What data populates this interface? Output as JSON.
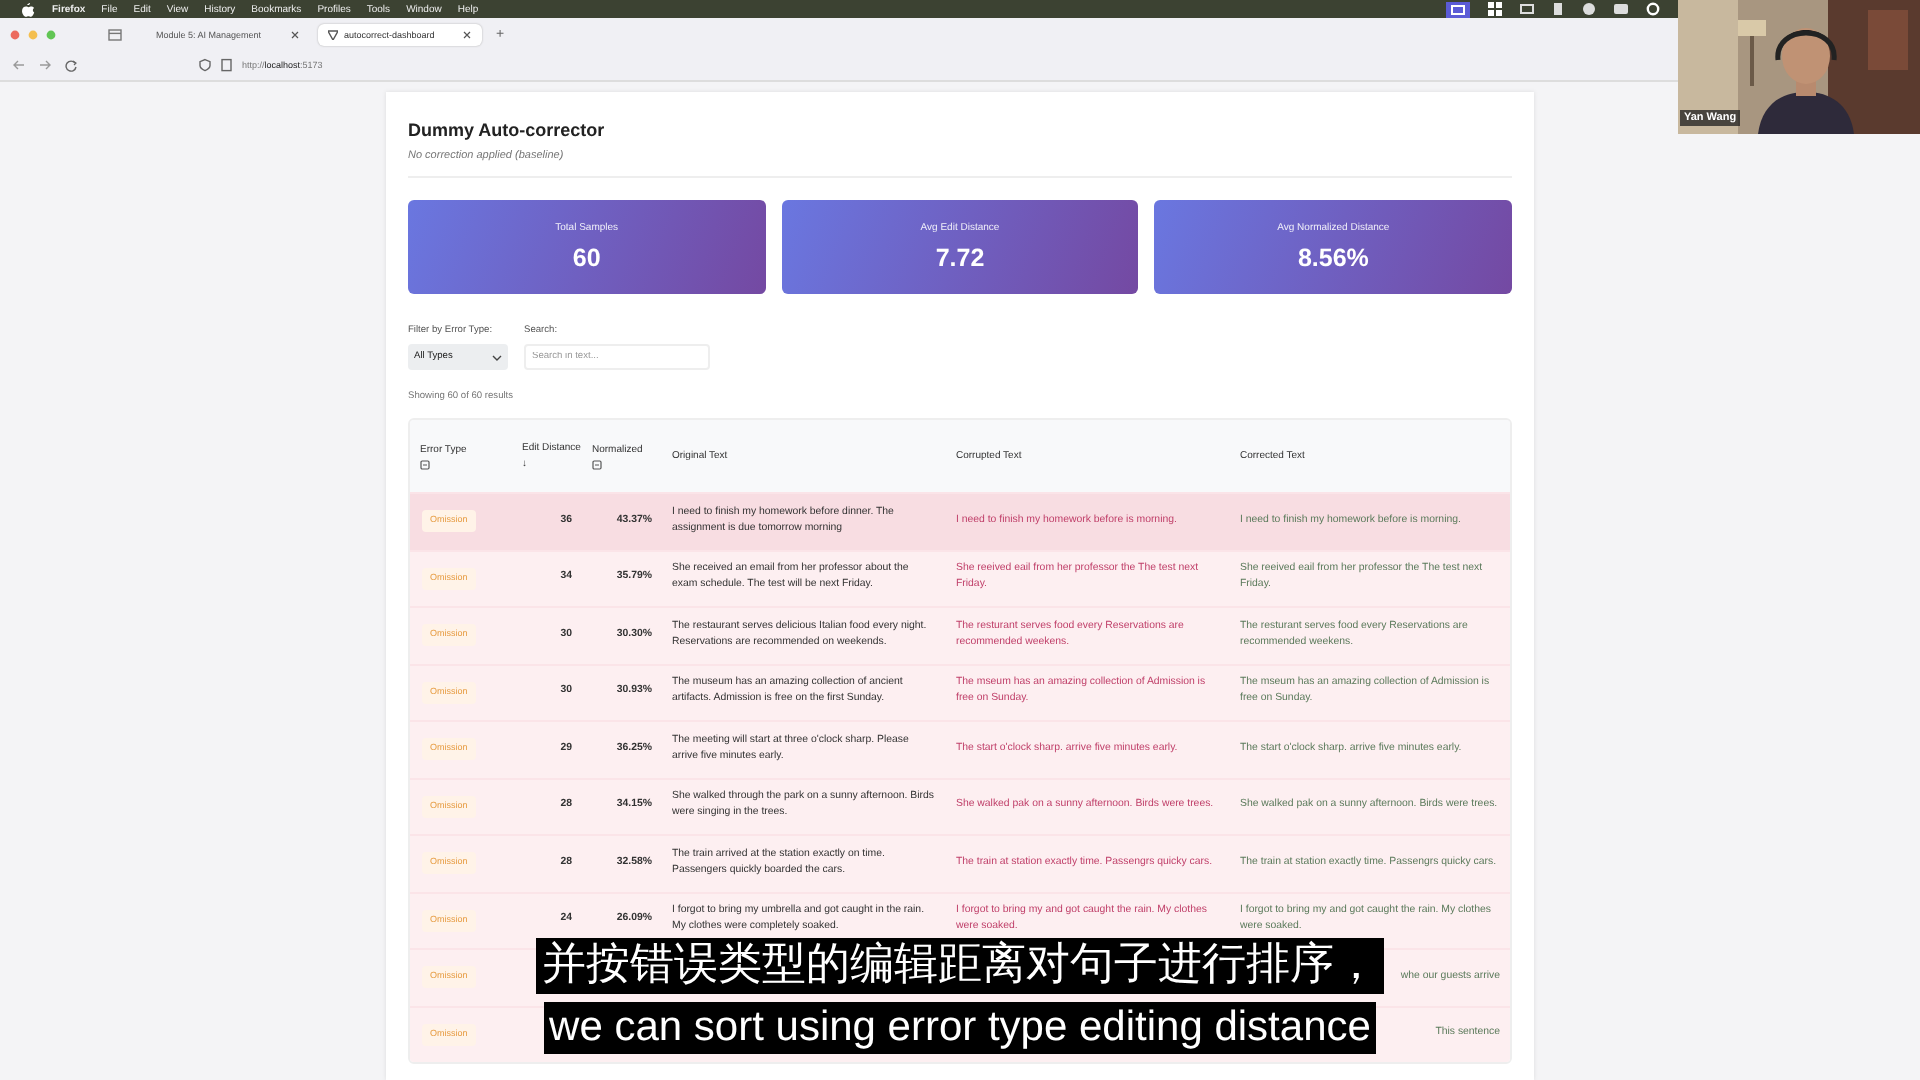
{
  "menu_bar": {
    "app": "Firefox",
    "items": [
      "File",
      "Edit",
      "View",
      "History",
      "Bookmarks",
      "Profiles",
      "Tools",
      "Window",
      "Help"
    ]
  },
  "browser": {
    "tabs": [
      {
        "label": "Module 5: AI Management",
        "selected": false
      },
      {
        "label": "autocorrect-dashboard",
        "selected": true
      }
    ],
    "new_tab": "+",
    "url": "http://**localhost**:5173"
  },
  "page": {
    "title": "Dummy Auto-corrector",
    "subtitle": "No correction applied (baseline)",
    "stats": [
      {
        "label": "Total Samples",
        "value": "60"
      },
      {
        "label": "Avg Edit Distance",
        "value": "7.72"
      },
      {
        "label": "Avg Normalized Distance",
        "value": "8.56%"
      }
    ],
    "filter": {
      "label": "Filter by Error Type:",
      "value": "All Types"
    },
    "search": {
      "label": "Search:",
      "placeholder": "Search in text..."
    },
    "results_count": "Showing 60 of 60 results",
    "table": {
      "columns": [
        {
          "label": "Error Type",
          "kind": "icon"
        },
        {
          "label": "Edit Distance",
          "kind": "sort",
          "sort": "↓"
        },
        {
          "label": "Normalized",
          "kind": "icon"
        },
        {
          "label": "Original Text",
          "kind": "plain"
        },
        {
          "label": "Corrupted Text",
          "kind": "plain"
        },
        {
          "label": "Corrected Text",
          "kind": "plain"
        }
      ],
      "rows": [
        {
          "error_type": "Omission",
          "edit_distance": "36",
          "normalized": "43.37%",
          "original": "I need to finish my homework before dinner. The assignment is due tomorrow morning",
          "corrupted": "I need to finish my homework before is morning.",
          "corrected": "I need to finish my homework before is morning.",
          "highlighted": true
        },
        {
          "error_type": "Omission",
          "edit_distance": "34",
          "normalized": "35.79%",
          "original": "She received an email from her professor about the exam schedule. The test will be next Friday.",
          "corrupted": "She reeived eail from her professor the The test next Friday.",
          "corrected": "She reeived eail from her professor the The test next Friday.",
          "highlighted": false
        },
        {
          "error_type": "Omission",
          "edit_distance": "30",
          "normalized": "30.30%",
          "original": "The restaurant serves delicious Italian food every night. Reservations are recommended on weekends.",
          "corrupted": "The resturant serves food every Reservations are recommended weekens.",
          "corrected": "The resturant serves food every Reservations are recommended weekens.",
          "highlighted": false
        },
        {
          "error_type": "Omission",
          "edit_distance": "30",
          "normalized": "30.93%",
          "original": "The museum has an amazing collection of ancient artifacts. Admission is free on the first Sunday.",
          "corrupted": "The mseum has an amazing collection of Admission is free on Sunday.",
          "corrected": "The mseum has an amazing collection of Admission is free on Sunday.",
          "highlighted": false
        },
        {
          "error_type": "Omission",
          "edit_distance": "29",
          "normalized": "36.25%",
          "original": "The meeting will start at three o'clock sharp. Please arrive five minutes early.",
          "corrupted": "The start o'clock sharp. arrive five minutes early.",
          "corrected": "The start o'clock sharp. arrive five minutes early.",
          "highlighted": false
        },
        {
          "error_type": "Omission",
          "edit_distance": "28",
          "normalized": "34.15%",
          "original": "She walked through the park on a sunny afternoon. Birds were singing in the trees.",
          "corrupted": "She walked pak on a sunny afternoon. Birds were trees.",
          "corrected": "She walked pak on a sunny afternoon. Birds were trees.",
          "highlighted": false
        },
        {
          "error_type": "Omission",
          "edit_distance": "28",
          "normalized": "32.58%",
          "original": "The train arrived at the station exactly on time. Passengers quickly boarded the cars.",
          "corrupted": "The train at station exactly time. Passengrs quicky cars.",
          "corrected": "The train at station exactly time. Passengrs quicky cars.",
          "highlighted": false
        },
        {
          "error_type": "Omission",
          "edit_distance": "24",
          "normalized": "26.09%",
          "original": "I forgot to bring my umbrella and got caught in the rain. My clothes were completely soaked.",
          "corrupted": "I forgot to bring my and got caught the rain. My clothes were soaked.",
          "corrected": "I forgot to bring my and got caught the rain. My clothes were soaked.",
          "highlighted": false
        },
        {
          "error_type": "Omission",
          "corrected": "whe our guests arrive",
          "highlighted": false
        },
        {
          "error_type": "Omission",
          "corrected": "This sentence",
          "highlighted": false
        }
      ]
    }
  },
  "video": {
    "name": "Yan Wang"
  },
  "subtitles": [
    "并按错误类型的编辑距离对句子进行排序，",
    "we can sort using error type editing distance"
  ]
}
